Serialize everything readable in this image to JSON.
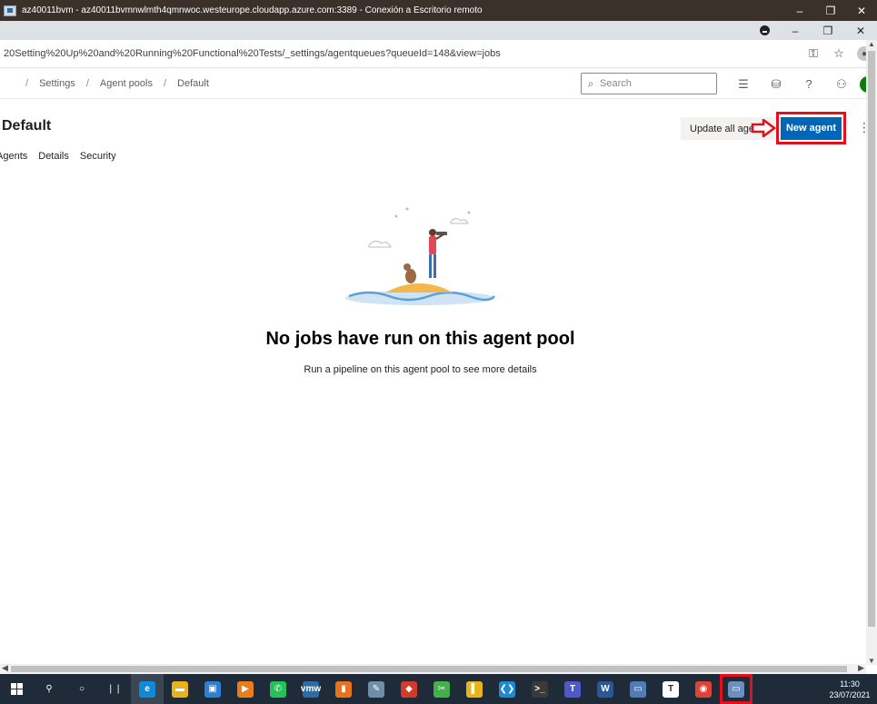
{
  "rdp_window": {
    "title": "az40011bvm - az40011bvmnwlmth4qmnwoc.westeurope.cloudapp.azure.com:3389 - Conexión a Escritorio remoto",
    "minimize": "–",
    "restore": "❐",
    "close": "✕"
  },
  "browser": {
    "minimize": "–",
    "restore": "❐",
    "close": "✕",
    "url": "20Setting%20Up%20and%20Running%20Functional%20Tests/_settings/agentqueues?queueId=148&view=jobs",
    "key_icon": "key-icon",
    "star_icon": "star-icon"
  },
  "ado": {
    "breadcrumb": [
      "Settings",
      "Agent pools",
      "Default"
    ],
    "search_placeholder": "Search",
    "page_title": "Default",
    "update_button": "Update all agents",
    "new_agent_button": "New agent",
    "more": "⋮",
    "tabs": [
      "Agents",
      "Details",
      "Security"
    ],
    "empty_title": "No jobs have run on this agent pool",
    "empty_subtitle": "Run a pipeline on this agent pool to see more details"
  },
  "taskbar": {
    "time": "11:30",
    "date": "23/07/2021",
    "apps": [
      {
        "name": "windows-start",
        "label": "",
        "color": "#1f2b38"
      },
      {
        "name": "search",
        "label": "⚲",
        "color": "#1f2b38"
      },
      {
        "name": "cortana",
        "label": "○",
        "color": "#1f2b38"
      },
      {
        "name": "task-view",
        "label": "❘❘",
        "color": "#1f2b38"
      },
      {
        "name": "edge",
        "label": "e",
        "color": "#0f8ad6"
      },
      {
        "name": "file-explorer",
        "label": "▬",
        "color": "#e8b21d"
      },
      {
        "name": "store",
        "label": "▣",
        "color": "#2d7fd3"
      },
      {
        "name": "media",
        "label": "▶",
        "color": "#e87d1c"
      },
      {
        "name": "whatsapp",
        "label": "✆",
        "color": "#25c05a"
      },
      {
        "name": "vmware",
        "label": "vmw",
        "color": "#2c6ca3"
      },
      {
        "name": "office",
        "label": "▮",
        "color": "#e8731c"
      },
      {
        "name": "paint",
        "label": "✎",
        "color": "#6f8fa8"
      },
      {
        "name": "git",
        "label": "◆",
        "color": "#d23a2c"
      },
      {
        "name": "snip",
        "label": "✂",
        "color": "#43b049"
      },
      {
        "name": "power-bi",
        "label": "▌",
        "color": "#e6b41b"
      },
      {
        "name": "vscode",
        "label": "❮❯",
        "color": "#1b8ad1"
      },
      {
        "name": "terminal",
        "label": ">_",
        "color": "#3a3a3a"
      },
      {
        "name": "teams",
        "label": "T",
        "color": "#5059c9"
      },
      {
        "name": "word",
        "label": "W",
        "color": "#2b579a"
      },
      {
        "name": "remote-desktop-app",
        "label": "▭",
        "color": "#4f7cb8"
      },
      {
        "name": "typora",
        "label": "T",
        "color": "#ffffff"
      },
      {
        "name": "chrome",
        "label": "◉",
        "color": "#db4437"
      },
      {
        "name": "remote-desktop",
        "label": "▭",
        "color": "#6b8fbf"
      }
    ]
  }
}
